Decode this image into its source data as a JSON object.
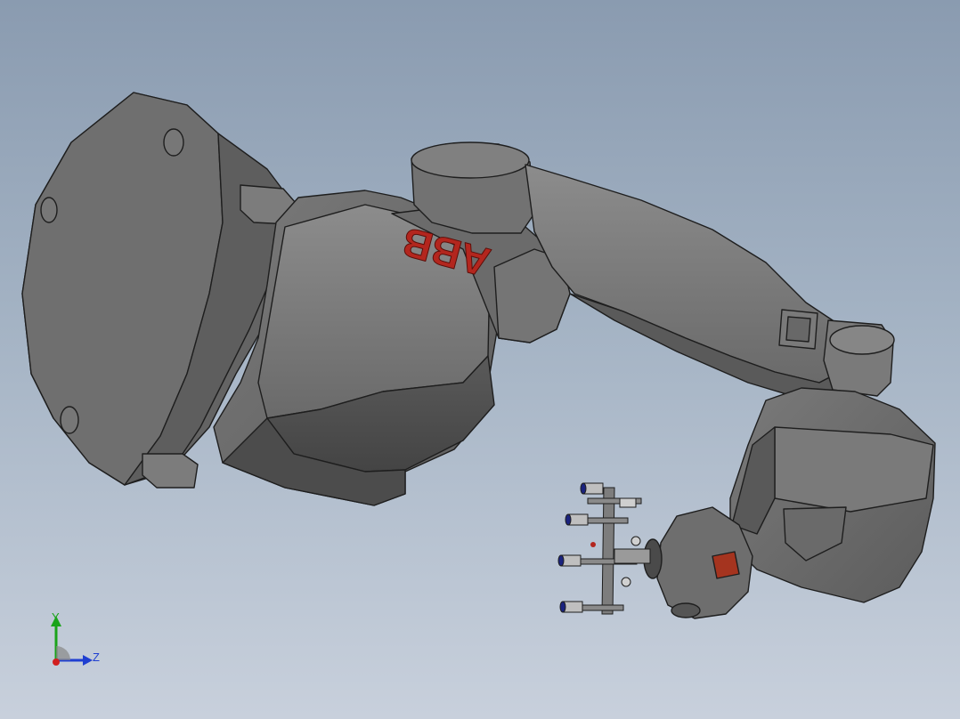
{
  "model": {
    "brand_logo_text": "ABB",
    "logo_color": "#b3261e",
    "body_color": "#6e6e6e",
    "viewport_bg_top": "#8a9bb0",
    "viewport_bg_bottom": "#c8d0dc"
  },
  "triad": {
    "y_label": "Y",
    "z_label": "Z",
    "y_color": "#1aa31a",
    "z_color": "#1f3fd1",
    "x_color": "#d11f1f"
  }
}
